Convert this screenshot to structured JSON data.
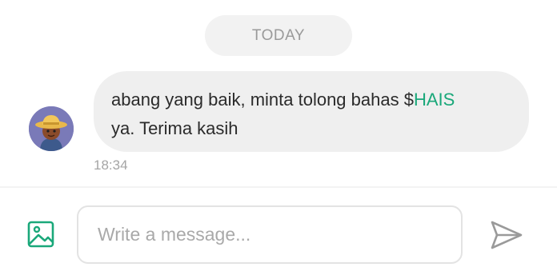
{
  "chat": {
    "date_label": "TODAY",
    "message": {
      "text_before": "abang yang baik, minta tolong bahas $",
      "ticker": "HAIS",
      "text_after": "ya. Terima kasih",
      "time": "18:34"
    }
  },
  "composer": {
    "placeholder": "Write a message..."
  },
  "icons": {
    "attach": "image-icon",
    "send": "send-icon",
    "avatar": "farmer-avatar"
  },
  "colors": {
    "accent": "#1aa87a",
    "bubble": "#efefef",
    "pill": "#f2f2f2"
  }
}
